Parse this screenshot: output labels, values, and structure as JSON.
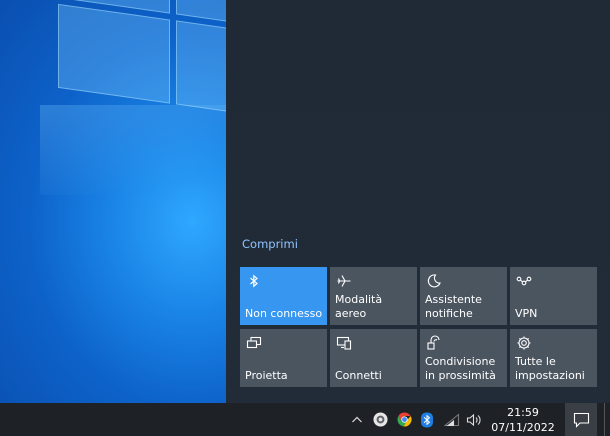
{
  "action_center": {
    "collapse_label": "Comprimi",
    "tiles": [
      {
        "label": "Non connesso",
        "icon": "bluetooth-icon",
        "active": true
      },
      {
        "label": "Modalità aereo",
        "icon": "airplane-icon",
        "active": false
      },
      {
        "label": "Assistente notifiche",
        "icon": "moon-icon",
        "active": false
      },
      {
        "label": "VPN",
        "icon": "vpn-icon",
        "active": false
      },
      {
        "label": "Proietta",
        "icon": "project-icon",
        "active": false
      },
      {
        "label": "Connetti",
        "icon": "connect-icon",
        "active": false
      },
      {
        "label": "Condivisione in prossimità",
        "icon": "nearby-share-icon",
        "active": false
      },
      {
        "label": "Tutte le impostazioni",
        "icon": "gear-icon",
        "active": false
      }
    ],
    "accent_color": "#3796f0"
  },
  "taskbar": {
    "time": "21:59",
    "date": "07/11/2022",
    "tray_icons": [
      "chevron-up-icon",
      "google-drive-icon",
      "chrome-icon",
      "bluetooth-icon",
      "wifi-icon",
      "volume-icon"
    ]
  }
}
